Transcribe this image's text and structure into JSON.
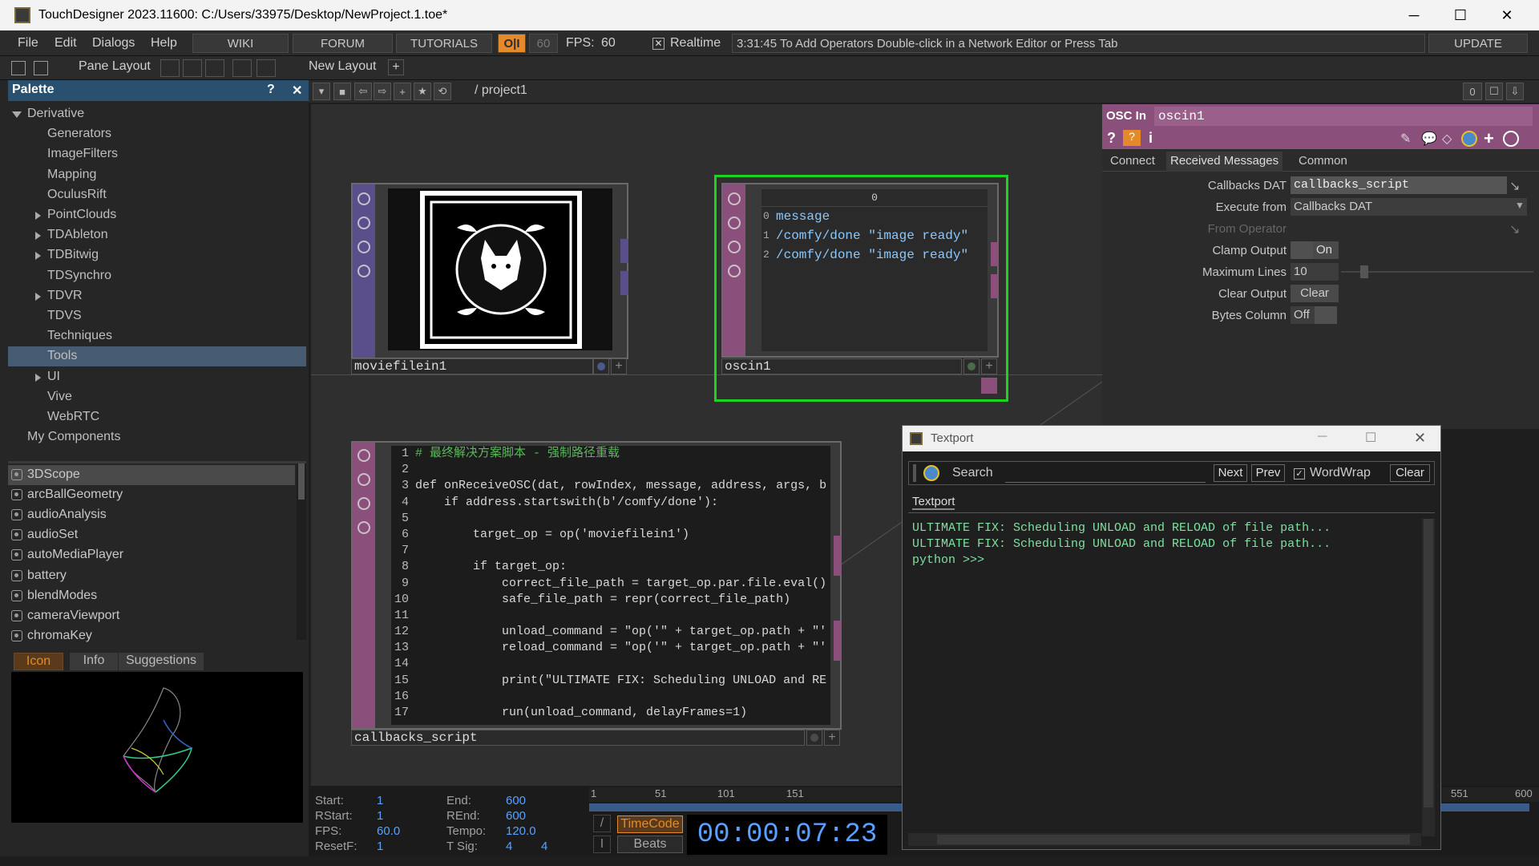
{
  "window": {
    "title": "TouchDesigner 2023.11600: C:/Users/33975/Desktop/NewProject.1.toe*",
    "controls": {
      "minimize": "─",
      "maximize": "☐",
      "close": "✕"
    }
  },
  "menubar": {
    "menus": [
      "File",
      "Edit",
      "Dialogs",
      "Help"
    ],
    "buttons": {
      "wiki": "WIKI",
      "forum": "FORUM",
      "tutorials": "TUTORIALS"
    },
    "oi": "O|I",
    "fps_target": "60",
    "fps_label": "FPS:",
    "fps_value": "60",
    "realtime_label": "Realtime",
    "status": "3:31:45 To Add Operators Double-click in a Network Editor or Press Tab",
    "update": "UPDATE"
  },
  "toolbar": {
    "pane_layout": "Pane Layout",
    "new_layout": "New Layout",
    "add": "+"
  },
  "palette": {
    "title": "Palette",
    "help": "?",
    "close": "✕",
    "tree": [
      {
        "label": "Derivative",
        "indent": 0,
        "expander": "down"
      },
      {
        "label": "Generators",
        "indent": 1
      },
      {
        "label": "ImageFilters",
        "indent": 1
      },
      {
        "label": "Mapping",
        "indent": 1
      },
      {
        "label": "OculusRift",
        "indent": 1
      },
      {
        "label": "PointClouds",
        "indent": 1,
        "expander": "right"
      },
      {
        "label": "TDAbleton",
        "indent": 1,
        "expander": "right"
      },
      {
        "label": "TDBitwig",
        "indent": 1,
        "expander": "right"
      },
      {
        "label": "TDSynchro",
        "indent": 1
      },
      {
        "label": "TDVR",
        "indent": 1,
        "expander": "right"
      },
      {
        "label": "TDVS",
        "indent": 1
      },
      {
        "label": "Techniques",
        "indent": 1
      },
      {
        "label": "Tools",
        "indent": 1,
        "selected": true
      },
      {
        "label": "UI",
        "indent": 1,
        "expander": "right"
      },
      {
        "label": "Vive",
        "indent": 1
      },
      {
        "label": "WebRTC",
        "indent": 1
      },
      {
        "label": "My Components",
        "indent": 0
      }
    ],
    "components": [
      "3DScope",
      "arcBallGeometry",
      "audioAnalysis",
      "audioSet",
      "autoMediaPlayer",
      "battery",
      "blendModes",
      "cameraViewport",
      "chromaKey"
    ],
    "tabs": {
      "icon": "Icon",
      "info": "Info",
      "suggestions": "Suggestions"
    }
  },
  "network": {
    "path": "/ project1",
    "counter": "0",
    "nodes": {
      "moviefilein": "moviefilein1",
      "oscin": "oscin1",
      "callbacks": "callbacks_script"
    },
    "osc_table": {
      "header": "0",
      "rows": [
        {
          "index": "0",
          "text": "message"
        },
        {
          "index": "1",
          "text": "/comfy/done \"image ready\""
        },
        {
          "index": "2",
          "text": "/comfy/done \"image ready\""
        }
      ]
    },
    "code": [
      {
        "n": "1",
        "text": "# 最终解决方案脚本 - 强制路径重载"
      },
      {
        "n": "2",
        "text": ""
      },
      {
        "n": "3",
        "text": "def onReceiveOSC(dat, rowIndex, message, address, args, b"
      },
      {
        "n": "4",
        "text": "    if address.startswith(b'/comfy/done'):"
      },
      {
        "n": "5",
        "text": ""
      },
      {
        "n": "6",
        "text": "        target_op = op('moviefilein1')"
      },
      {
        "n": "7",
        "text": ""
      },
      {
        "n": "8",
        "text": "        if target_op:"
      },
      {
        "n": "9",
        "text": "            correct_file_path = target_op.par.file.eval()"
      },
      {
        "n": "10",
        "text": "            safe_file_path = repr(correct_file_path)"
      },
      {
        "n": "11",
        "text": ""
      },
      {
        "n": "12",
        "text": "            unload_command = \"op('\" + target_op.path + \"'"
      },
      {
        "n": "13",
        "text": "            reload_command = \"op('\" + target_op.path + \"'"
      },
      {
        "n": "14",
        "text": ""
      },
      {
        "n": "15",
        "text": "            print(\"ULTIMATE FIX: Scheduling UNLOAD and RE"
      },
      {
        "n": "16",
        "text": ""
      },
      {
        "n": "17",
        "text": "            run(unload_command, delayFrames=1)"
      }
    ]
  },
  "params": {
    "type": "OSC In",
    "name": "oscin1",
    "tabs": {
      "connect": "Connect",
      "received": "Received Messages",
      "common": "Common"
    },
    "rows": {
      "callbacks_dat_label": "Callbacks DAT",
      "callbacks_dat_value": "callbacks_script",
      "execute_from_label": "Execute from",
      "execute_from_value": "Callbacks DAT",
      "from_operator_label": "From Operator",
      "clamp_output_label": "Clamp Output",
      "clamp_output_value": "On",
      "max_lines_label": "Maximum Lines",
      "max_lines_value": "10",
      "clear_output_label": "Clear Output",
      "clear_output_value": "Clear",
      "bytes_column_label": "Bytes Column",
      "bytes_column_value": "Off"
    }
  },
  "textport": {
    "title": "Textport",
    "search_label": "Search",
    "next": "Next",
    "prev": "Prev",
    "wordwrap": "WordWrap",
    "clear": "Clear",
    "tab": "Textport",
    "lines": [
      "ULTIMATE FIX: Scheduling UNLOAD and RELOAD of file path...",
      "ULTIMATE FIX: Scheduling UNLOAD and RELOAD of file path...",
      "python >>>"
    ]
  },
  "timeline": {
    "start_label": "Start:",
    "start": "1",
    "rstart_label": "RStart:",
    "rstart": "1",
    "fps_label": "FPS:",
    "fps": "60.0",
    "resetf_label": "ResetF:",
    "resetf": "1",
    "end_label": "End:",
    "end": "600",
    "rend_label": "REnd:",
    "rend": "600",
    "tempo_label": "Tempo:",
    "tempo": "120.0",
    "tsig_label": "T Sig:",
    "tsig_a": "4",
    "tsig_b": "4",
    "ruler": [
      "1",
      "51",
      "101",
      "151",
      "551",
      "600"
    ],
    "timecode_label": "TimeCode",
    "beats_label": "Beats",
    "timecode": "00:00:07:23"
  },
  "colors": {
    "accent_blue": "#29506e",
    "selection_green": "#1dd31d",
    "osc_pink": "#8a4f7a",
    "top_purple": "#5a4f8a",
    "timecode_orange": "#e58a2a"
  }
}
